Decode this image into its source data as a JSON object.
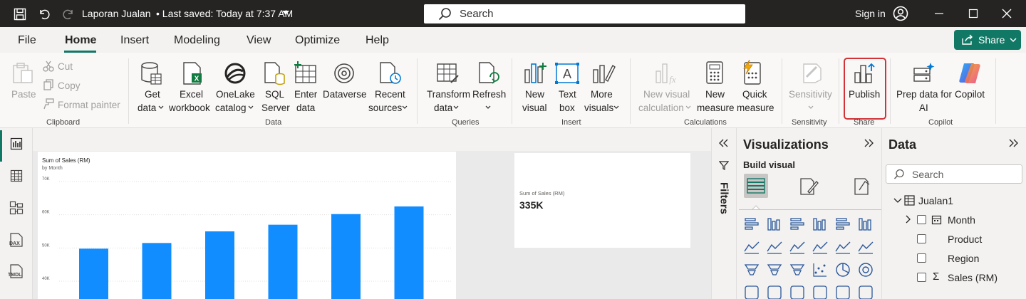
{
  "titlebar": {
    "title": "Laporan Jualan",
    "saved": "• Last saved: Today at 7:37 AM",
    "search_label": "Search",
    "signin": "Sign in",
    "icons": [
      "save-icon",
      "undo-icon",
      "redo-icon",
      "dropdown-caret-icon",
      "search-icon",
      "avatar-icon",
      "minimize-icon",
      "maximize-icon",
      "close-icon"
    ]
  },
  "tabs": [
    "File",
    "Home",
    "Insert",
    "Modeling",
    "View",
    "Optimize",
    "Help"
  ],
  "active_tab": "Home",
  "share": {
    "label": "Share"
  },
  "ribbon": {
    "clipboard": {
      "paste": "Paste",
      "cut": "Cut",
      "copy": "Copy",
      "format_painter": "Format painter",
      "group": "Clipboard"
    },
    "data": {
      "get_data_1": "Get",
      "get_data_2": "data",
      "excel_1": "Excel",
      "excel_2": "workbook",
      "onelake_1": "OneLake",
      "onelake_2": "catalog",
      "sql_1": "SQL",
      "sql_2": "Server",
      "enter_1": "Enter",
      "enter_2": "data",
      "dataverse": "Dataverse",
      "recent_1": "Recent",
      "recent_2": "sources",
      "group": "Data"
    },
    "queries": {
      "transform_1": "Transform",
      "transform_2": "data",
      "refresh": "Refresh",
      "group": "Queries"
    },
    "insert": {
      "new_visual_1": "New",
      "new_visual_2": "visual",
      "text_box_1": "Text",
      "text_box_2": "box",
      "more_visuals_1": "More",
      "more_visuals_2": "visuals",
      "group": "Insert"
    },
    "calculations": {
      "new_visual_calc_1": "New visual",
      "new_visual_calc_2": "calculation",
      "new_measure_1": "New",
      "new_measure_2": "measure",
      "quick_measure_1": "Quick",
      "quick_measure_2": "measure",
      "group": "Calculations"
    },
    "sensitivity": {
      "label": "Sensitivity",
      "group": "Sensitivity"
    },
    "share": {
      "publish": "Publish",
      "group": "Share"
    },
    "copilot": {
      "prep_1": "Prep data for",
      "prep_2": "AI",
      "copilot": "Copilot",
      "group": "Copilot"
    }
  },
  "rail": {
    "dax": "DAX",
    "tmdl": "TMDL"
  },
  "filters": {
    "label": "Filters"
  },
  "viz_pane": {
    "title": "Visualizations",
    "build": "Build visual"
  },
  "data_pane": {
    "title": "Data",
    "search_placeholder": "Search",
    "table": "Jualan1",
    "fields": [
      "Month",
      "Product",
      "Region",
      "Sales (RM)"
    ]
  },
  "kpi": {
    "label": "Sum of Sales (RM)",
    "value": "335K"
  },
  "colors": {
    "accent": "#117865",
    "bar": "#118dff",
    "publish_highlight": "#d13438"
  },
  "chart_data": {
    "type": "bar",
    "title": "Sum of Sales (RM)",
    "subtitle": "by Month",
    "y_ticks": [
      "70K",
      "60K",
      "50K",
      "40K"
    ],
    "ylim": [
      40000,
      70000
    ],
    "values": [
      49800,
      51500,
      55000,
      57000,
      60200,
      62500
    ],
    "grid": true
  }
}
